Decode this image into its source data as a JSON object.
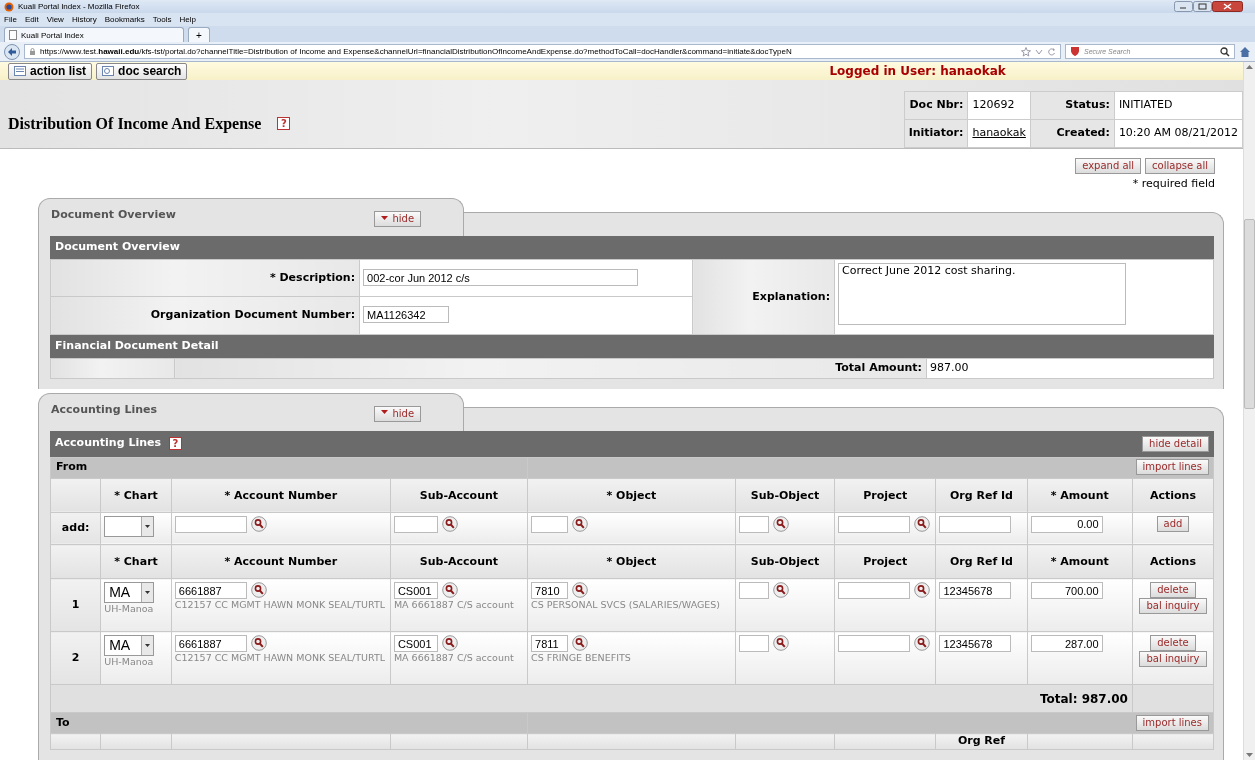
{
  "browser": {
    "window_title": "Kuali Portal Index - Mozilla Firefox",
    "menu": [
      "File",
      "Edit",
      "View",
      "History",
      "Bookmarks",
      "Tools",
      "Help"
    ],
    "tab_title": "Kuali Portal Index",
    "new_tab": "+",
    "url": "https://www.test.**hawaii.edu**/kfs-tst/portal.do?channelTitle=Distribution of Income and Expense&channelUrl=financialDistributionOfIncomeAndExpense.do?methodToCall=docHandler&command=initiate&docTypeN",
    "search_placeholder": "Secure Search"
  },
  "top_strip": {
    "buttons": [
      "action list",
      "doc search"
    ],
    "logged_in": "Logged in User: hanaokak"
  },
  "doc_header": {
    "title": "Distribution Of Income And Expense",
    "help": "?",
    "fields": [
      {
        "label": "Doc Nbr:",
        "value": "120692",
        "kind": "text"
      },
      {
        "label": "Status:",
        "value": "INITIATED",
        "kind": "text"
      },
      {
        "label": "Initiator:",
        "value": "hanaokak",
        "kind": "link"
      },
      {
        "label": "Created:",
        "value": "10:20 AM 08/21/2012",
        "kind": "text"
      }
    ]
  },
  "page_buttons": [
    "expand all",
    "collapse all"
  ],
  "required_note": "* required field",
  "overview_tab": {
    "label": "Document Overview",
    "hide": "hide",
    "expanded": true
  },
  "overview": {
    "title": "Document Overview",
    "description_label": "* Description:",
    "description": "002-cor Jun 2012 c/s",
    "org_doc_label": "Organization Document Number:",
    "org_doc": "MA1126342",
    "explanation_label": "Explanation:",
    "explanation": "Correct June 2012 cost sharing.",
    "financial_title": "Financial Document Detail",
    "total_label": "Total Amount:",
    "total": "987.00"
  },
  "accounting_tab": {
    "label": "Accounting Lines",
    "hide": "hide",
    "expanded": true
  },
  "accounting": {
    "title": "Accounting Lines",
    "help": "?",
    "hide_detail": "hide detail",
    "from": {
      "label": "From",
      "import": "import lines",
      "add_columns": [
        "* Chart",
        "* Account Number",
        "Sub-Account",
        "* Object",
        "Sub-Object",
        "Project",
        "Org Ref Id",
        "* Amount",
        "Actions"
      ],
      "add_row": {
        "label": "add:",
        "amount": "0.00",
        "action": "add"
      },
      "line_columns": [
        "* Chart",
        "* Account Number",
        "Sub-Account",
        "* Object",
        "Sub-Object",
        "Project",
        "Org Ref Id",
        "* Amount",
        "Actions"
      ],
      "lines": [
        {
          "number": "1",
          "chart": "MA",
          "chart_name": "UH-Manoa",
          "account": "6661887",
          "account_name": "C12157 CC MGMT HAWN MONK SEAL/TURTL",
          "sub_account": "CS001",
          "sub_account_name": "MA 6661887 C/S account",
          "object": "7810",
          "object_name": "CS PERSONAL SVCS (SALARIES/WAGES)",
          "org_ref_id": "12345678",
          "amount": "700.00",
          "actions": [
            "delete",
            "bal inquiry"
          ]
        },
        {
          "number": "2",
          "chart": "MA",
          "chart_name": "UH-Manoa",
          "account": "6661887",
          "account_name": "C12157 CC MGMT HAWN MONK SEAL/TURTL",
          "sub_account": "CS001",
          "sub_account_name": "MA 6661887 C/S account",
          "object": "7811",
          "object_name": "CS FRINGE BENEFITS",
          "org_ref_id": "12345678",
          "amount": "287.00",
          "actions": [
            "delete",
            "bal inquiry"
          ]
        }
      ],
      "total": "Total: 987.00"
    },
    "to": {
      "label": "To",
      "import": "import lines",
      "column_7": "Org Ref"
    }
  }
}
